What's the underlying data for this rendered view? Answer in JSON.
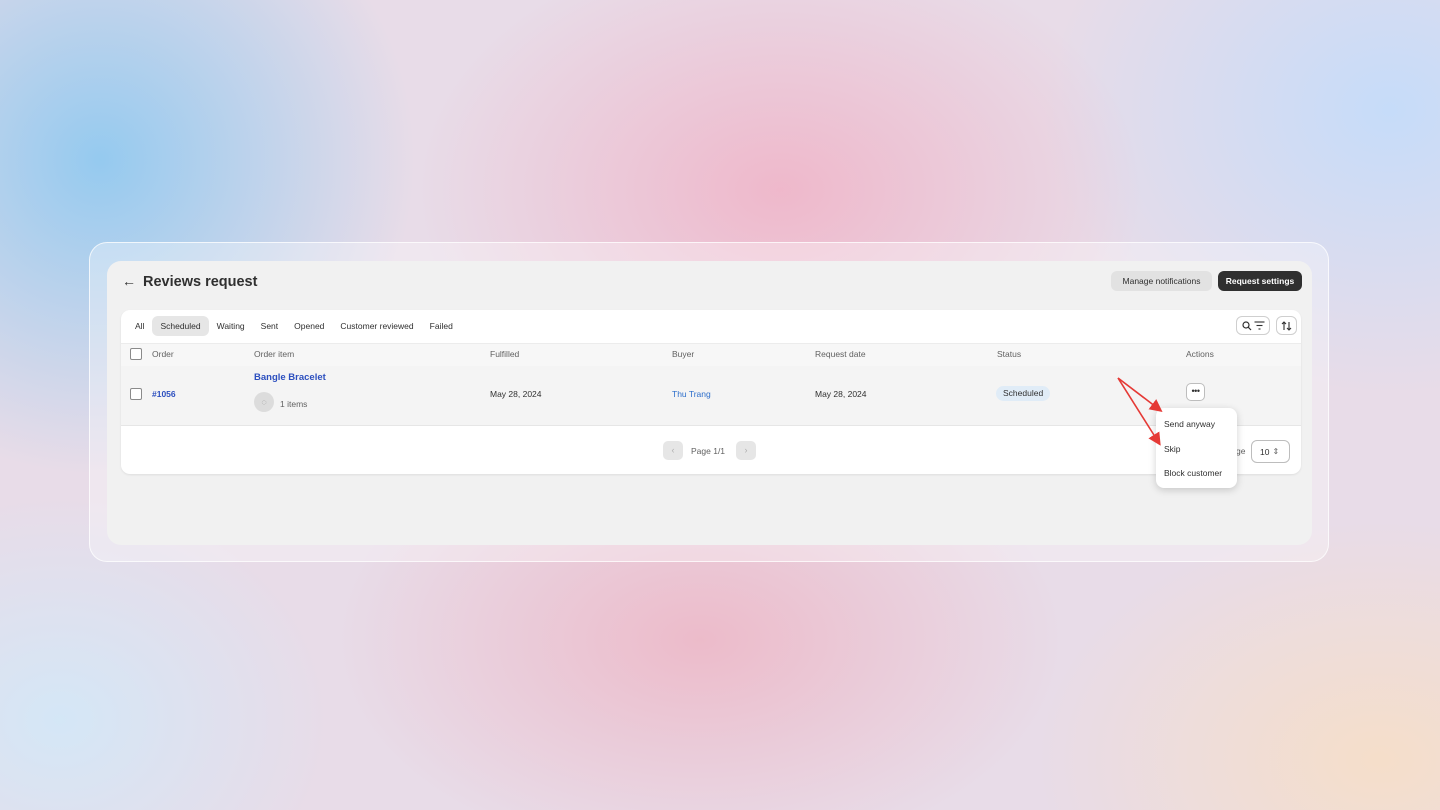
{
  "header": {
    "back_icon": "←",
    "title": "Reviews request",
    "manage_notifications_label": "Manage notifications",
    "request_settings_label": "Request settings"
  },
  "tabs": [
    {
      "label": "All",
      "active": false
    },
    {
      "label": "Scheduled",
      "active": true
    },
    {
      "label": "Waiting",
      "active": false
    },
    {
      "label": "Sent",
      "active": false
    },
    {
      "label": "Opened",
      "active": false
    },
    {
      "label": "Customer reviewed",
      "active": false
    },
    {
      "label": "Failed",
      "active": false
    }
  ],
  "toolbar": {
    "search_filter_icon": "search-filter-icon",
    "sort_icon": "sort-icon"
  },
  "table": {
    "columns": [
      "Order",
      "Order item",
      "Fulfilled",
      "Buyer",
      "Request date",
      "Status",
      "Actions"
    ],
    "rows": [
      {
        "order": "#1056",
        "item_name": "Bangle Bracelet",
        "item_count": "1 items",
        "fulfilled": "May 28, 2024",
        "buyer": "Thu Trang",
        "request_date": "May 28, 2024",
        "status": "Scheduled",
        "actions_label": "•••"
      }
    ]
  },
  "pagination": {
    "prev_icon": "‹",
    "next_icon": "›",
    "page_text": "Page 1/1",
    "per_page_label_fragment": "ge",
    "per_page_value": "10",
    "per_page_icon": "⇕"
  },
  "actions_menu": {
    "items": [
      "Send anyway",
      "Skip",
      "Block customer"
    ]
  },
  "colors": {
    "annotation_arrow": "#e53935",
    "primary_button": "#303030",
    "link": "#2c4fbf"
  }
}
